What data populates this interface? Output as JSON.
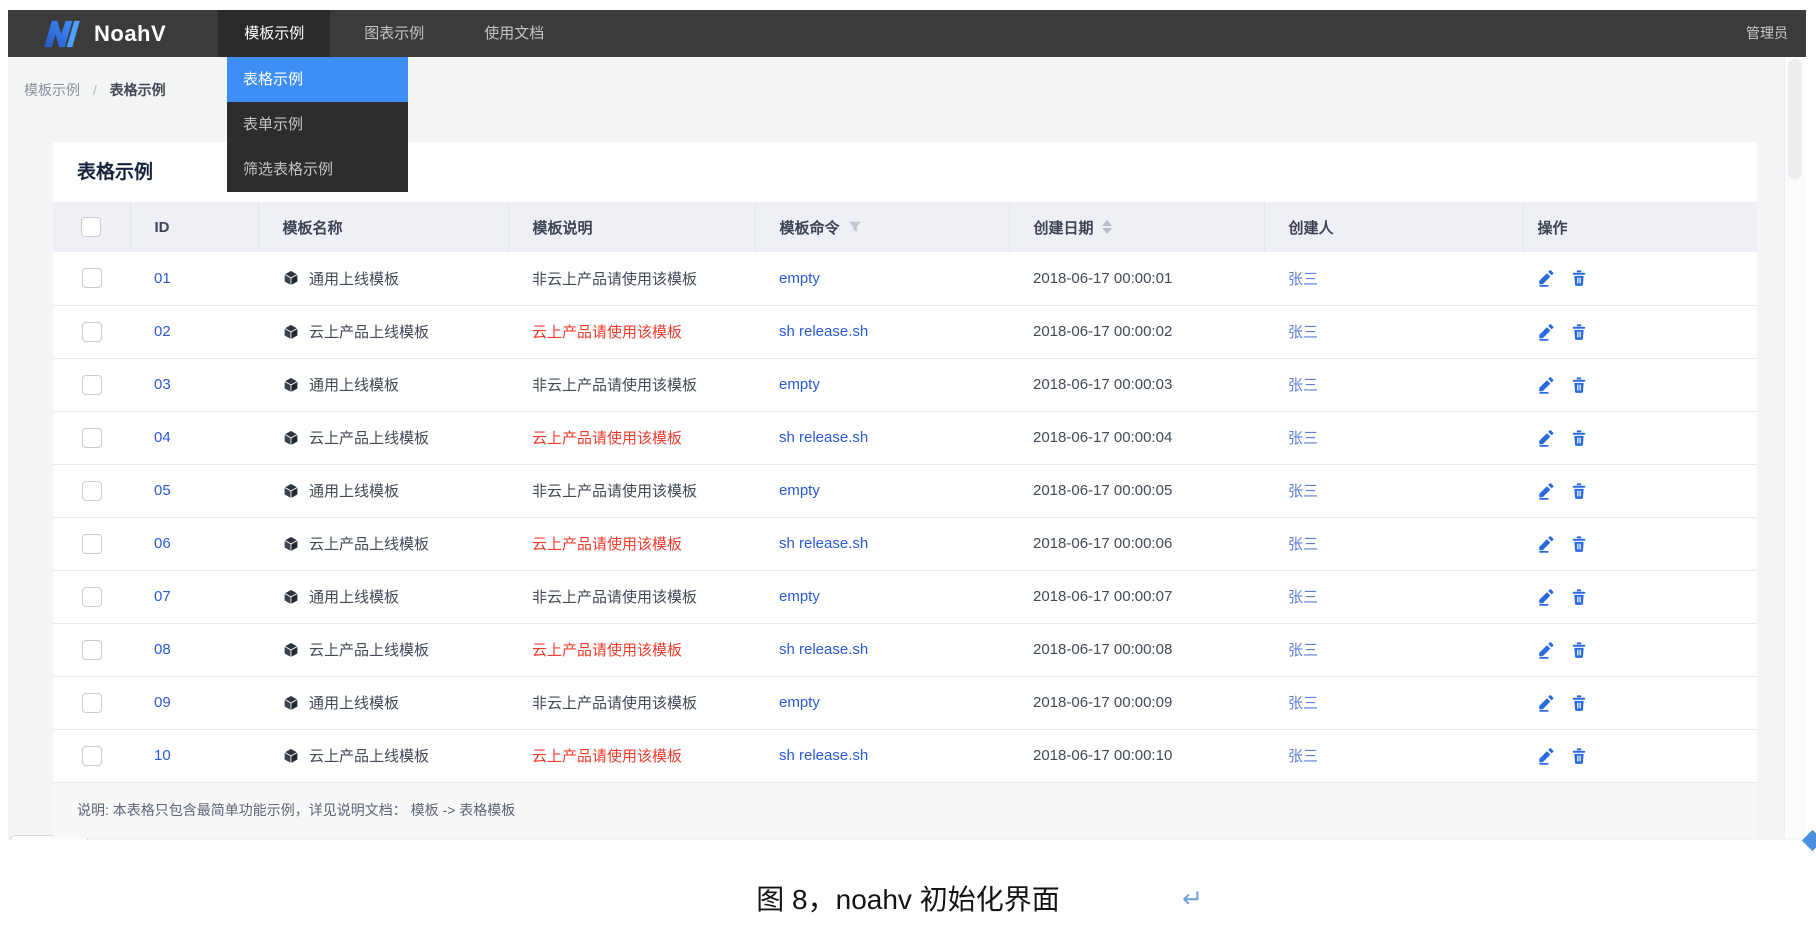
{
  "navbar": {
    "logo_text": "NoahV",
    "menu": [
      {
        "label": "模板示例",
        "active": true
      },
      {
        "label": "图表示例",
        "active": false
      },
      {
        "label": "使用文档",
        "active": false
      }
    ],
    "user": "管理员"
  },
  "dropdown": {
    "items": [
      {
        "label": "表格示例",
        "selected": true
      },
      {
        "label": "表单示例",
        "selected": false
      },
      {
        "label": "筛选表格示例",
        "selected": false
      }
    ]
  },
  "breadcrumb": {
    "items": [
      "模板示例",
      "表格示例"
    ],
    "separator": "/"
  },
  "page": {
    "card_title": "表格示例"
  },
  "table": {
    "columns": [
      "ID",
      "模板名称",
      "模板说明",
      "模板命令",
      "创建日期",
      "创建人",
      "操作"
    ],
    "rows": [
      {
        "id": "01",
        "name": "通用上线模板",
        "desc": "非云上产品请使用该模板",
        "warn": false,
        "cmd": "empty",
        "date": "2018-06-17 00:00:01",
        "creator": "张三"
      },
      {
        "id": "02",
        "name": "云上产品上线模板",
        "desc": "云上产品请使用该模板",
        "warn": true,
        "cmd": "sh release.sh",
        "date": "2018-06-17 00:00:02",
        "creator": "张三"
      },
      {
        "id": "03",
        "name": "通用上线模板",
        "desc": "非云上产品请使用该模板",
        "warn": false,
        "cmd": "empty",
        "date": "2018-06-17 00:00:03",
        "creator": "张三"
      },
      {
        "id": "04",
        "name": "云上产品上线模板",
        "desc": "云上产品请使用该模板",
        "warn": true,
        "cmd": "sh release.sh",
        "date": "2018-06-17 00:00:04",
        "creator": "张三"
      },
      {
        "id": "05",
        "name": "通用上线模板",
        "desc": "非云上产品请使用该模板",
        "warn": false,
        "cmd": "empty",
        "date": "2018-06-17 00:00:05",
        "creator": "张三"
      },
      {
        "id": "06",
        "name": "云上产品上线模板",
        "desc": "云上产品请使用该模板",
        "warn": true,
        "cmd": "sh release.sh",
        "date": "2018-06-17 00:00:06",
        "creator": "张三"
      },
      {
        "id": "07",
        "name": "通用上线模板",
        "desc": "非云上产品请使用该模板",
        "warn": false,
        "cmd": "empty",
        "date": "2018-06-17 00:00:07",
        "creator": "张三"
      },
      {
        "id": "08",
        "name": "云上产品上线模板",
        "desc": "云上产品请使用该模板",
        "warn": true,
        "cmd": "sh release.sh",
        "date": "2018-06-17 00:00:08",
        "creator": "张三"
      },
      {
        "id": "09",
        "name": "通用上线模板",
        "desc": "非云上产品请使用该模板",
        "warn": false,
        "cmd": "empty",
        "date": "2018-06-17 00:00:09",
        "creator": "张三"
      },
      {
        "id": "10",
        "name": "云上产品上线模板",
        "desc": "云上产品请使用该模板",
        "warn": true,
        "cmd": "sh release.sh",
        "date": "2018-06-17 00:00:10",
        "creator": "张三"
      }
    ],
    "footnote": "说明: 本表格只包含最简单功能示例，详见说明文档： 模板 -> 表格模板"
  },
  "caption": {
    "text": "图 8，noahv 初始化界面",
    "return_mark": "↵"
  },
  "icons": {
    "logo": "noahv-logo-mark",
    "package": "package-cube-icon",
    "filter": "filter-funnel-icon",
    "sort": "sort-carets-icon",
    "edit": "edit-pencil-icon",
    "delete": "trash-icon"
  },
  "colors": {
    "navbar_bg": "#3b3b3c",
    "navbar_active_bg": "#2a2a2b",
    "dropdown_bg": "#2d2d2e",
    "dropdown_selected": "#3e8ef7",
    "page_bg": "#f4f5f7",
    "header_bg": "#eef0f6",
    "link_blue": "#2b5ad8",
    "creator_blue": "#5e7fd5",
    "danger_red": "#ef3c2d",
    "anchor_blue": "#4a90e2"
  }
}
